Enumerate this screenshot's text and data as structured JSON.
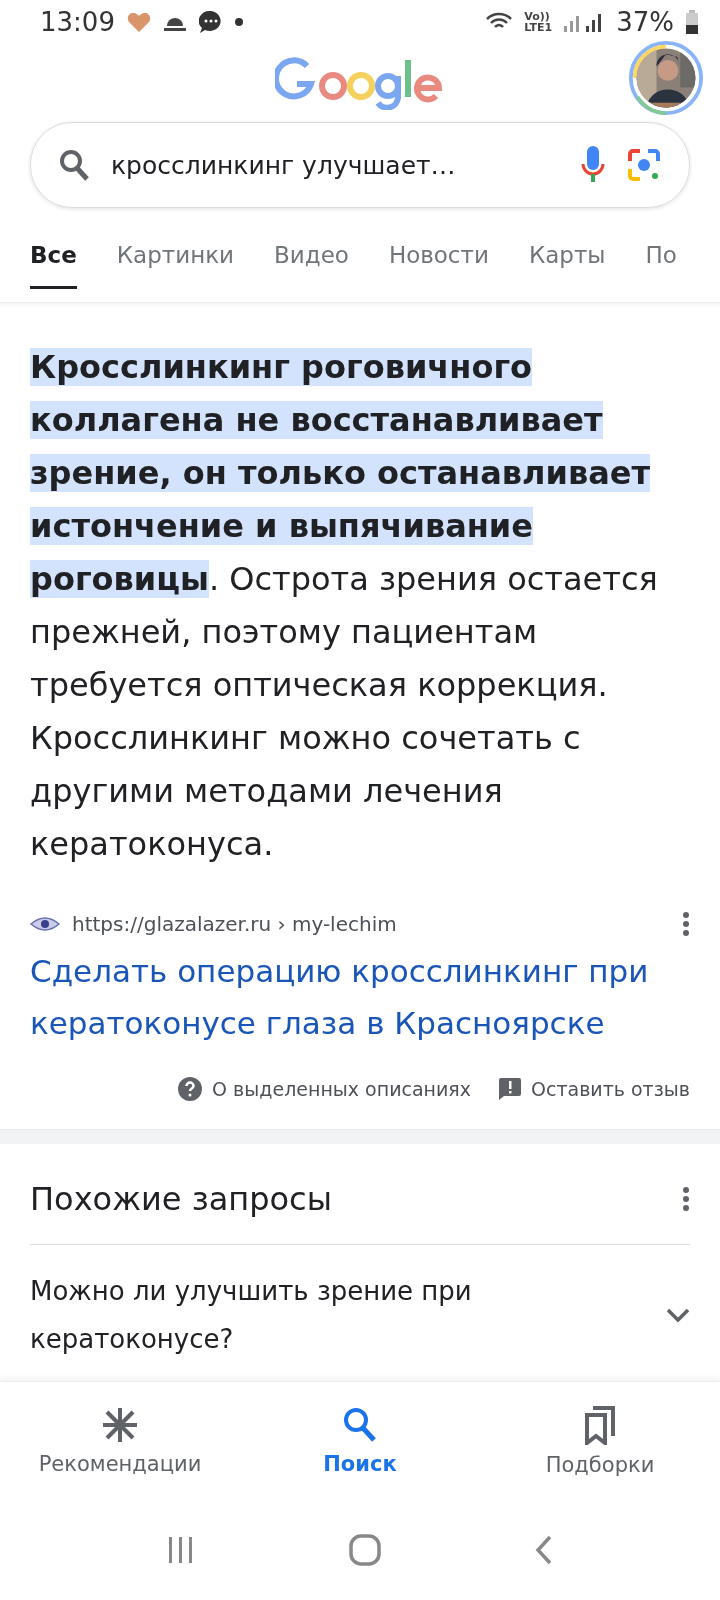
{
  "status_bar": {
    "time": "13:09",
    "network_top": "Vo))",
    "network_bottom": "LTE1",
    "battery": "37%"
  },
  "search": {
    "value": "кросслинкинг улучшает…"
  },
  "tabs": [
    {
      "label": "Все",
      "selected": true
    },
    {
      "label": "Картинки",
      "selected": false
    },
    {
      "label": "Видео",
      "selected": false
    },
    {
      "label": "Новости",
      "selected": false
    },
    {
      "label": "Карты",
      "selected": false
    },
    {
      "label": "По",
      "selected": false
    }
  ],
  "featured_snippet": {
    "text": "**Кросслинкинг роговичного коллагена не восстанавливает зрение, он только останавливает истончение и выпячивание роговицы**. Острота зрения остается прежней, поэтому пациентам требуется оптическая коррекция. Кросслинкинг можно сочетать с другими методами лечения кератоконуса.",
    "source_url": "https://glazalazer.ru › my-lechim",
    "title": "Сделать операцию кросслинкинг при кератоконусе глаза в Красноярске",
    "about_link": "О выделенных описаниях",
    "feedback_link": "Оставить отзыв"
  },
  "related": {
    "title": "Похожие запросы",
    "items": [
      {
        "text": "Можно ли улучшить зрение при кератоконусе?",
        "expanded": false
      }
    ]
  },
  "bottom_nav": [
    {
      "label": "Рекомендации",
      "selected": false
    },
    {
      "label": "Поиск",
      "selected": true
    },
    {
      "label": "Подборки",
      "selected": false
    }
  ]
}
